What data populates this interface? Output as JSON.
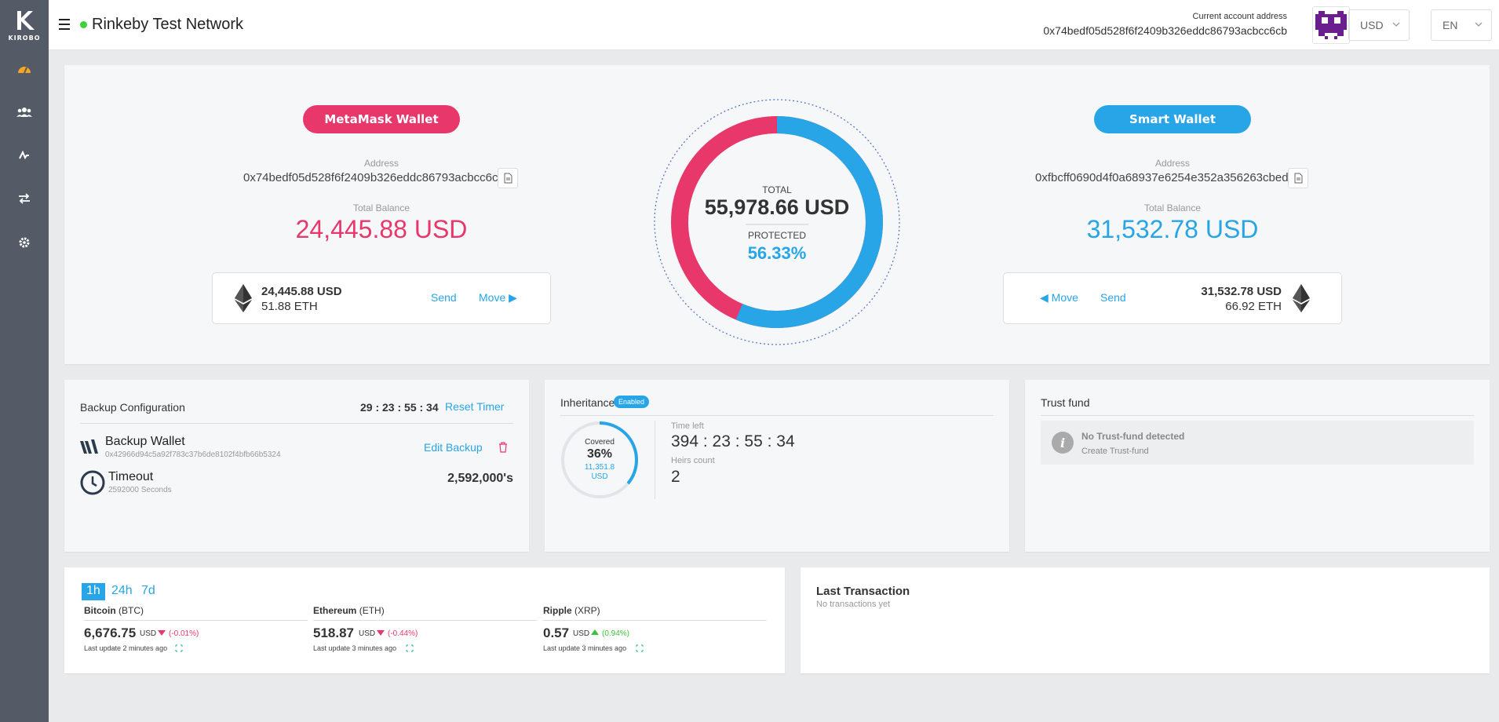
{
  "brand": {
    "logo_text": "KIRОBO"
  },
  "sidebar": {
    "items": [
      {
        "icon": "dashboard-icon",
        "color": "#f5a623"
      },
      {
        "icon": "users-icon"
      },
      {
        "icon": "activity-icon"
      },
      {
        "icon": "transfer-icon"
      },
      {
        "icon": "settings-icon"
      }
    ]
  },
  "header": {
    "network": "Rinkeby Test Network",
    "network_status_color": "#3dd23a",
    "account_label": "Current account address",
    "account_address": "0x74bedf05d528f6f2409b326eddc86793acbcc6cb",
    "currency": "USD",
    "language": "EN"
  },
  "metamask": {
    "button": "MetaMask Wallet",
    "address_label": "Address",
    "address": "0x74bedf05d528f6f2409b326eddc86793acbcc6cb",
    "balance_label": "Total Balance",
    "balance": "24,445.88 USD",
    "asset_usd": "24,445.88 USD",
    "asset_eth": "51.88 ETH",
    "send": "Send",
    "move": "Move ▶",
    "color": "#e8376b"
  },
  "smart": {
    "button": "Smart Wallet",
    "address_label": "Address",
    "address": "0xfbcff0690d4f0a68937e6254e352a356263cbed2",
    "balance_label": "Total Balance",
    "balance": "31,532.78 USD",
    "asset_usd": "31,532.78 USD",
    "asset_eth": "66.92 ETH",
    "send": "Send",
    "move": "◀ Move",
    "color": "#27a5e6"
  },
  "summary": {
    "total_label": "TOTAL",
    "total": "55,978.66 USD",
    "protected_label": "PROTECTED",
    "protected": "56.33%",
    "protected_fraction": 0.5633
  },
  "backup": {
    "title": "Backup Configuration",
    "timer": "29 : 23 : 55 : 34",
    "reset": "Reset Timer",
    "wallet_name": "Backup Wallet",
    "wallet_address": "0x42966d94c5a92f783c37b6de8102f4bfb66b5324",
    "edit": "Edit Backup",
    "timeout_label": "Timeout",
    "timeout_seconds": "2592000 Seconds",
    "timeout_value": "2,592,000's"
  },
  "inheritance": {
    "title": "Inheritance",
    "badge": "Enabled",
    "covered_label": "Covered",
    "covered_pct": "36%",
    "covered_fraction": 0.36,
    "covered_amount": "11,351.8",
    "covered_cur": "USD",
    "time_left_label": "Time left",
    "time_left": "394 : 23 : 55 : 34",
    "heirs_label": "Heirs count",
    "heirs": "2"
  },
  "trust": {
    "title": "Trust fund",
    "none": "No Trust-fund detected",
    "create": "Create Trust-fund"
  },
  "market": {
    "tabs": [
      "1h",
      "24h",
      "7d"
    ],
    "active_tab": "1h",
    "coins": [
      {
        "name": "Bitcoin",
        "sym": "(BTC)",
        "price": "6,676.75",
        "cur": "USD",
        "change": "(-0.01%)",
        "dir": "down",
        "updated": "Last update  2 minutes ago"
      },
      {
        "name": "Ethereum",
        "sym": "(ETH)",
        "price": "518.87",
        "cur": "USD",
        "change": "(-0.44%)",
        "dir": "down",
        "updated": "Last update  3 minutes ago"
      },
      {
        "name": "Ripple",
        "sym": "(XRP)",
        "price": "0.57",
        "cur": "USD",
        "change": "(0.94%)",
        "dir": "up",
        "updated": "Last update  3 minutes ago"
      }
    ]
  },
  "last_tx": {
    "title": "Last Transaction",
    "empty": "No transactions yet"
  }
}
